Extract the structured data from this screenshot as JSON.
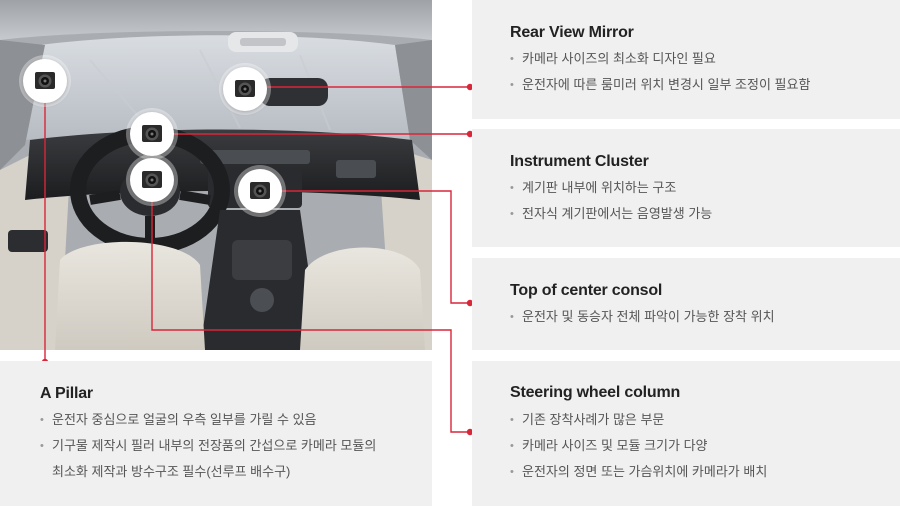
{
  "panels": {
    "rear_view_mirror": {
      "title": "Rear View Mirror",
      "items": [
        "카메라 사이즈의 최소화 디자인 필요",
        "운전자에 따른 룸미러 위치 변경시 일부 조정이 필요함"
      ]
    },
    "instrument_cluster": {
      "title": "Instrument Cluster",
      "items": [
        "계기판 내부에 위치하는 구조",
        "전자식 계기판에서는 음영발생 가능"
      ]
    },
    "top_of_center_consol": {
      "title": "Top of center consol",
      "items": [
        "운전자 및 동승자 전체 파악이 가능한 장착 위치"
      ]
    },
    "steering_wheel_column": {
      "title": "Steering wheel column",
      "items": [
        "기존 장착사례가 많은 부문",
        "카메라 사이즈 및 모듈 크기가 다양",
        "운전자의 정면 또는 가슴위치에 카메라가 배치"
      ]
    },
    "a_pillar": {
      "title": "A Pillar",
      "items": [
        "운전자 중심으로 얼굴의 우측 일부를 가릴 수 있음",
        "기구물 제작시 필러 내부의 전장품의 간섭으로 카메라 모듈의 최소화 제작과 방수구조 필수(선루프 배수구)"
      ]
    }
  },
  "colors": {
    "connector": "#d9263a",
    "panel_bg": "#f0f0f0"
  },
  "icons": {
    "camera": "camera-module-icon"
  }
}
